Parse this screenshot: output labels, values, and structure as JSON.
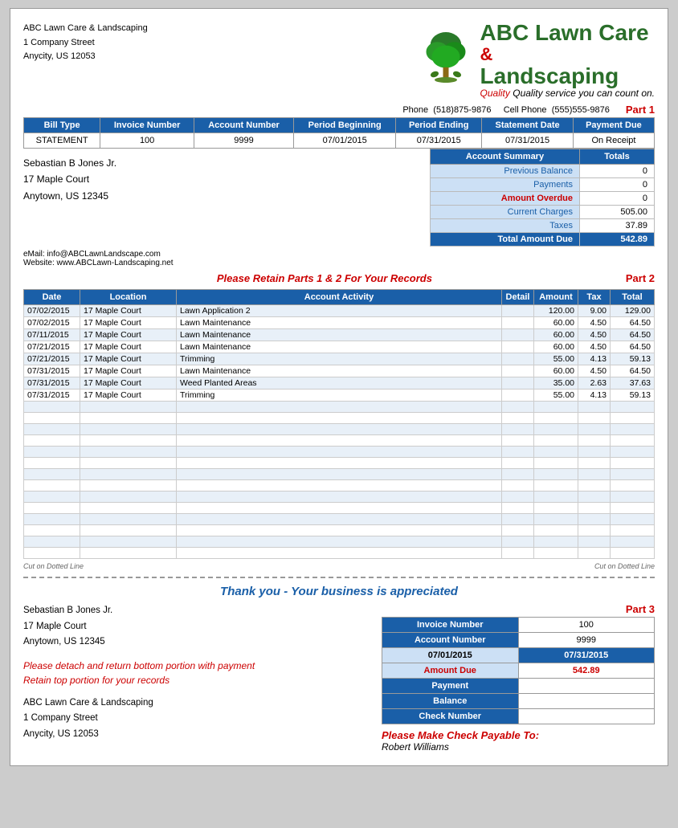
{
  "company": {
    "name_line1": "ABC Lawn Care & Landscaping",
    "name_abc": "ABC Lawn Care",
    "name_ampersand": "&",
    "name_landscaping": "Landscaping",
    "quality": "Quality service you can count on.",
    "address1": "1 Company Street",
    "city": "Anycity, US  12053",
    "phone_label": "Phone",
    "phone": "(518)875-9876",
    "cell_label": "Cell Phone",
    "cell": "(555)555-9876",
    "email": "eMail:  info@ABCLawnLandscape.com",
    "website": "Website:  www.ABCLawn-Landscaping.net"
  },
  "part_labels": {
    "part1": "Part 1",
    "part2": "Part 2",
    "part3": "Part 3"
  },
  "invoice_header": {
    "cols": [
      "Bill Type",
      "Invoice Number",
      "Account Number",
      "Period Beginning",
      "Period Ending",
      "Statement Date",
      "Payment Due"
    ],
    "row": [
      "STATEMENT",
      "100",
      "9999",
      "07/01/2015",
      "07/31/2015",
      "07/31/2015",
      "On Receipt"
    ]
  },
  "account_summary": {
    "title": "Account Summary",
    "totals_col": "Totals",
    "rows": [
      {
        "label": "Previous Balance",
        "value": "0"
      },
      {
        "label": "Payments",
        "value": "0"
      },
      {
        "label": "Amount Overdue",
        "value": "0"
      },
      {
        "label": "Current Charges",
        "value": "505.00"
      },
      {
        "label": "Taxes",
        "value": "37.89"
      }
    ],
    "total_label": "Total Amount Due",
    "total_value": "542.89"
  },
  "customer": {
    "name": "Sebastian B Jones Jr.",
    "address1": "17 Maple Court",
    "city": "Anytown, US  12345"
  },
  "retain_message": "Please Retain Parts 1 & 2 For Your Records",
  "activity_table": {
    "cols": [
      "Date",
      "Location",
      "Account Activity",
      "Detail",
      "Amount",
      "Tax",
      "Total"
    ],
    "rows": [
      {
        "date": "07/02/2015",
        "location": "17 Maple Court",
        "activity": "Lawn Application 2",
        "detail": "",
        "amount": "120.00",
        "tax": "9.00",
        "total": "129.00"
      },
      {
        "date": "07/02/2015",
        "location": "17 Maple Court",
        "activity": "Lawn Maintenance",
        "detail": "",
        "amount": "60.00",
        "tax": "4.50",
        "total": "64.50"
      },
      {
        "date": "07/11/2015",
        "location": "17 Maple Court",
        "activity": "Lawn Maintenance",
        "detail": "",
        "amount": "60.00",
        "tax": "4.50",
        "total": "64.50"
      },
      {
        "date": "07/21/2015",
        "location": "17 Maple Court",
        "activity": "Lawn Maintenance",
        "detail": "",
        "amount": "60.00",
        "tax": "4.50",
        "total": "64.50"
      },
      {
        "date": "07/21/2015",
        "location": "17 Maple Court",
        "activity": "Trimming",
        "detail": "",
        "amount": "55.00",
        "tax": "4.13",
        "total": "59.13"
      },
      {
        "date": "07/31/2015",
        "location": "17 Maple Court",
        "activity": "Lawn Maintenance",
        "detail": "",
        "amount": "60.00",
        "tax": "4.50",
        "total": "64.50"
      },
      {
        "date": "07/31/2015",
        "location": "17 Maple Court",
        "activity": "Weed Planted Areas",
        "detail": "",
        "amount": "35.00",
        "tax": "2.63",
        "total": "37.63"
      },
      {
        "date": "07/31/2015",
        "location": "17 Maple Court",
        "activity": "Trimming",
        "detail": "",
        "amount": "55.00",
        "tax": "4.13",
        "total": "59.13"
      }
    ]
  },
  "cut_labels": {
    "left": "Cut on Dotted Line",
    "right": "Cut on Dotted Line"
  },
  "thank_you": "Thank you - Your business is appreciated",
  "bottom_left": {
    "customer_name": "Sebastian B Jones Jr.",
    "address1": "17 Maple Court",
    "city": "Anytown, US  12345",
    "detach_line1": "Please detach and return bottom portion with payment",
    "detach_line2": "Retain top portion for your records",
    "company_name": "ABC Lawn Care & Landscaping",
    "company_address": "1 Company Street",
    "company_city": "Anycity, US  12053"
  },
  "payment_table": {
    "rows": [
      {
        "label": "Invoice Number",
        "value": "100"
      },
      {
        "label": "Account Number",
        "value": "9999"
      },
      {
        "date_label": "07/01/2015",
        "date_value": "07/31/2015"
      },
      {
        "label": "Amount Due",
        "value": "542.89"
      },
      {
        "label": "Payment",
        "value": ""
      },
      {
        "label": "Balance",
        "value": ""
      },
      {
        "label": "Check Number",
        "value": ""
      }
    ],
    "check_payable": "Please Make Check Payable To:",
    "payable_name": "Robert Williams"
  }
}
